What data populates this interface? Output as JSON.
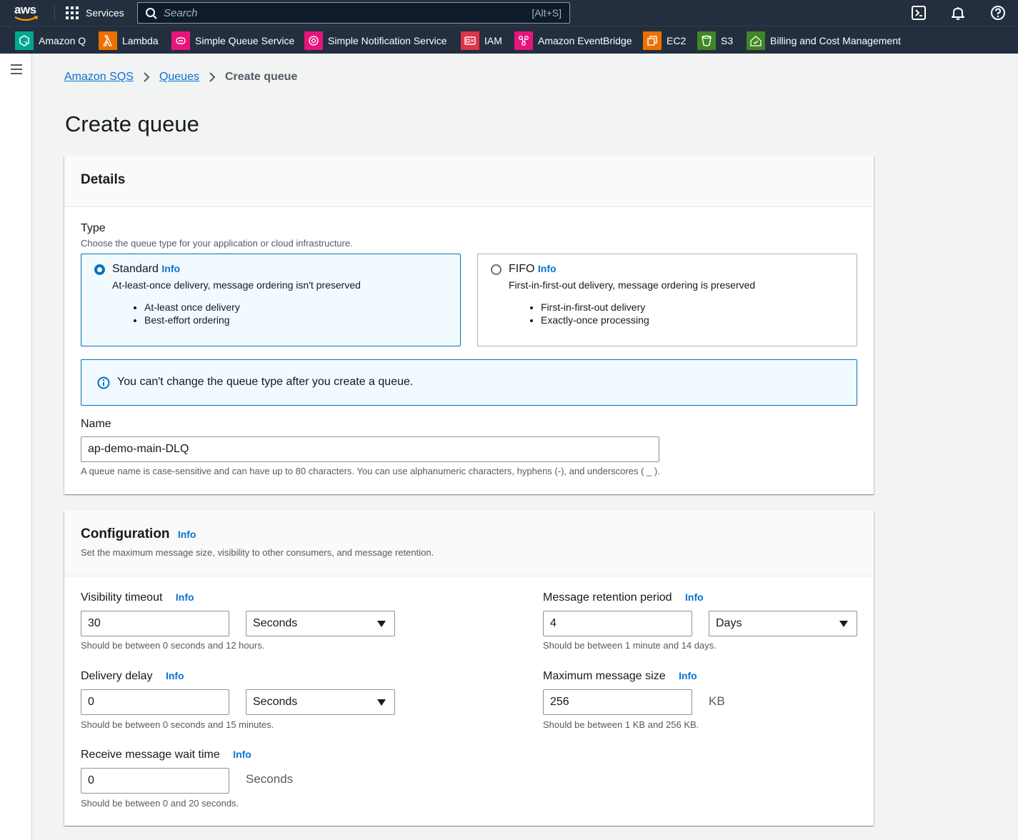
{
  "topbar": {
    "logo_text": "aws",
    "services_label": "Services",
    "search_placeholder": "Search",
    "search_shortcut": "[Alt+S]"
  },
  "favorites": [
    {
      "label": "Amazon Q",
      "icon": "amazon-q-icon",
      "color": "#01a88d"
    },
    {
      "label": "Lambda",
      "icon": "lambda-icon",
      "color": "#ed7100"
    },
    {
      "label": "Simple Queue Service",
      "icon": "sqs-icon",
      "color": "#e7157b"
    },
    {
      "label": "Simple Notification Service",
      "icon": "sns-icon",
      "color": "#e7157b"
    },
    {
      "label": "IAM",
      "icon": "iam-icon",
      "color": "#dd344c"
    },
    {
      "label": "Amazon EventBridge",
      "icon": "eventbridge-icon",
      "color": "#e7157b"
    },
    {
      "label": "EC2",
      "icon": "ec2-icon",
      "color": "#ed7100"
    },
    {
      "label": "S3",
      "icon": "s3-icon",
      "color": "#3f8624"
    },
    {
      "label": "Billing and Cost Management",
      "icon": "billing-icon",
      "color": "#3f8624"
    }
  ],
  "breadcrumb": {
    "items": [
      "Amazon SQS",
      "Queues"
    ],
    "current": "Create queue"
  },
  "page_title": "Create queue",
  "details": {
    "title": "Details",
    "type_label": "Type",
    "type_desc": "Choose the queue type for your application or cloud infrastructure.",
    "standard": {
      "name": "Standard",
      "info": "Info",
      "desc": "At-least-once delivery, message ordering isn't preserved",
      "bullets": [
        "At-least once delivery",
        "Best-effort ordering"
      ],
      "selected": true
    },
    "fifo": {
      "name": "FIFO",
      "info": "Info",
      "desc": "First-in-first-out delivery, message ordering is preserved",
      "bullets": [
        "First-in-first-out delivery",
        "Exactly-once processing"
      ],
      "selected": false
    },
    "alert_text": "You can't change the queue type after you create a queue.",
    "name_label": "Name",
    "name_value": "ap-demo-main-DLQ",
    "name_hint": "A queue name is case-sensitive and can have up to 80 characters. You can use alphanumeric characters, hyphens (-), and underscores ( _ )."
  },
  "configuration": {
    "title": "Configuration",
    "info": "Info",
    "desc": "Set the maximum message size, visibility to other consumers, and message retention.",
    "visibility_timeout": {
      "label": "Visibility timeout",
      "info": "Info",
      "value": "30",
      "unit": "Seconds",
      "hint": "Should be between 0 seconds and 12 hours."
    },
    "retention_period": {
      "label": "Message retention period",
      "info": "Info",
      "value": "4",
      "unit": "Days",
      "hint": "Should be between 1 minute and 14 days."
    },
    "delivery_delay": {
      "label": "Delivery delay",
      "info": "Info",
      "value": "0",
      "unit": "Seconds",
      "hint": "Should be between 0 seconds and 15 minutes."
    },
    "max_message_size": {
      "label": "Maximum message size",
      "info": "Info",
      "value": "256",
      "unit": "KB",
      "hint": "Should be between 1 KB and 256 KB."
    },
    "receive_wait_time": {
      "label": "Receive message wait time",
      "info": "Info",
      "value": "0",
      "unit": "Seconds",
      "hint": "Should be between 0 and 20 seconds."
    }
  }
}
